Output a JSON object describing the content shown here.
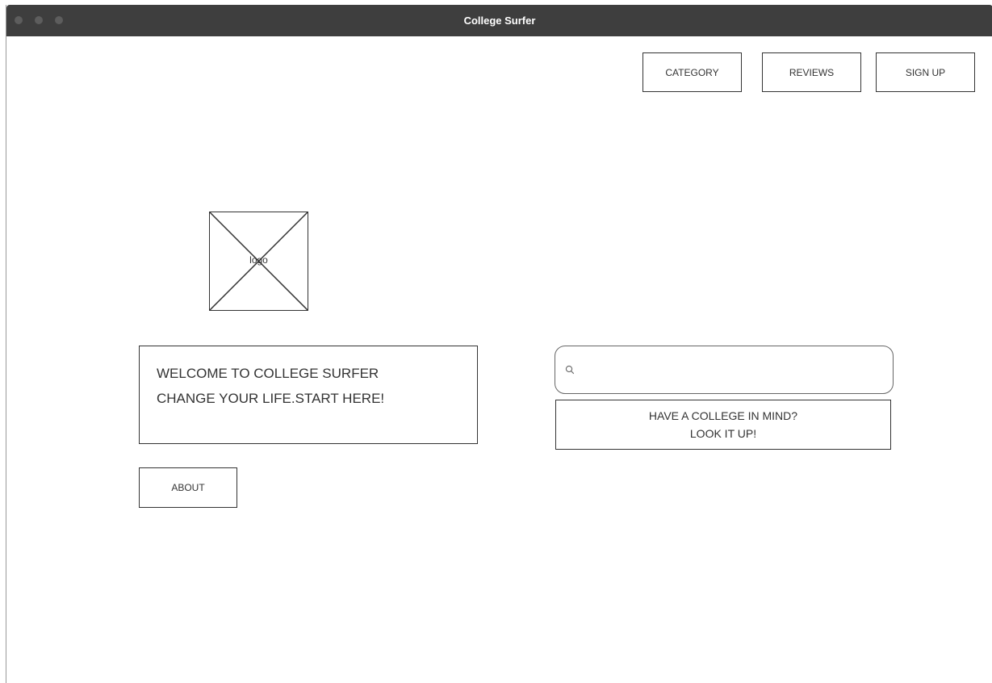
{
  "window": {
    "title": "College Surfer"
  },
  "nav": {
    "items": [
      {
        "label": "CATEGORY"
      },
      {
        "label": "REVIEWS"
      },
      {
        "label": "SIGN UP"
      }
    ]
  },
  "logo": {
    "label": "logo"
  },
  "welcome": {
    "line1": "WELCOME TO COLLEGE SURFER",
    "line2": "CHANGE YOUR LIFE.START HERE!"
  },
  "about": {
    "label": "ABOUT"
  },
  "search": {
    "value": "",
    "placeholder": "",
    "icon": "search-icon"
  },
  "lookup": {
    "line1": "HAVE A COLLEGE IN MIND?",
    "line2": "LOOK IT UP!"
  },
  "colors": {
    "titlebar": "#3e3e3e",
    "traffic_light": "#5d5d5d",
    "border": "#333333",
    "text": "#333333"
  }
}
